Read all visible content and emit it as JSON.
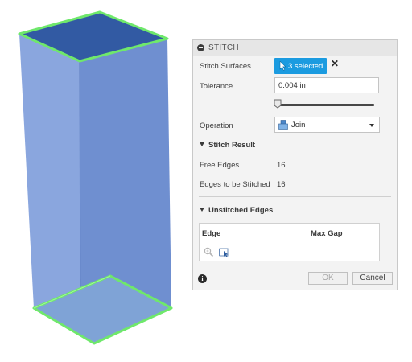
{
  "viewport": {
    "selection_color": "#6fe86b",
    "body_color": "#7c9bd8",
    "top_color": "#355ea8"
  },
  "panel": {
    "title": "STITCH",
    "stitch_surfaces": {
      "label": "Stitch Surfaces",
      "button": "3 selected",
      "clear": "✕"
    },
    "tolerance": {
      "label": "Tolerance",
      "value": "0.004 in",
      "slider_level": 0.0
    },
    "operation": {
      "label": "Operation",
      "value": "Join"
    },
    "stitch_result": {
      "heading": "Stitch Result",
      "free_edges": {
        "label": "Free Edges",
        "value": "16"
      },
      "edges_to_stitch": {
        "label": "Edges to be Stitched",
        "value": "16"
      }
    },
    "unstitched": {
      "heading": "Unstitched Edges",
      "columns": [
        "Edge",
        "Max Gap"
      ]
    },
    "buttons": {
      "ok": "OK",
      "cancel": "Cancel"
    },
    "info": "i"
  },
  "colors": {
    "accent": "#1b9be0"
  }
}
